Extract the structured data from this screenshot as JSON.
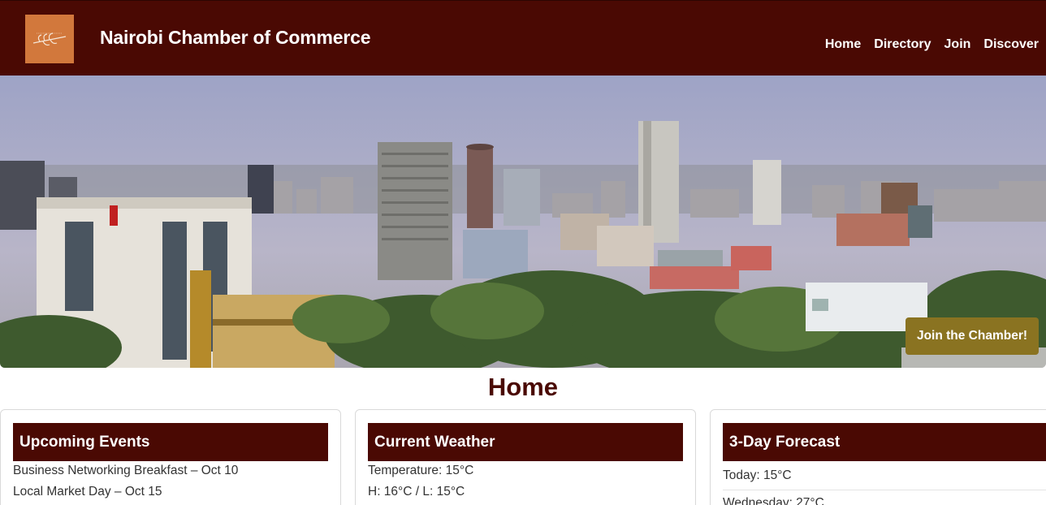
{
  "site": {
    "title": "Nairobi Chamber of Commerce",
    "logo_icon": "olive-branch-icon"
  },
  "nav": {
    "items": [
      "Home",
      "Directory",
      "Join",
      "Discover"
    ]
  },
  "hero": {
    "image": "nairobi-skyline-photo",
    "cta_label": "Join the Chamber!"
  },
  "page": {
    "heading": "Home"
  },
  "events": {
    "title": "Upcoming Events",
    "items": [
      "Business Networking Breakfast – Oct 10",
      "Local Market Day – Oct 15"
    ]
  },
  "weather": {
    "title": "Current Weather",
    "temperature": "Temperature: 15°C",
    "high_low": "H: 16°C / L: 15°C"
  },
  "forecast": {
    "title": "3-Day Forecast",
    "days": [
      "Today: 15°C",
      "Wednesday: 27°C"
    ]
  },
  "colors": {
    "brand": "#4a0903",
    "accent": "#8a7321",
    "logo_bg": "#d2783c"
  }
}
